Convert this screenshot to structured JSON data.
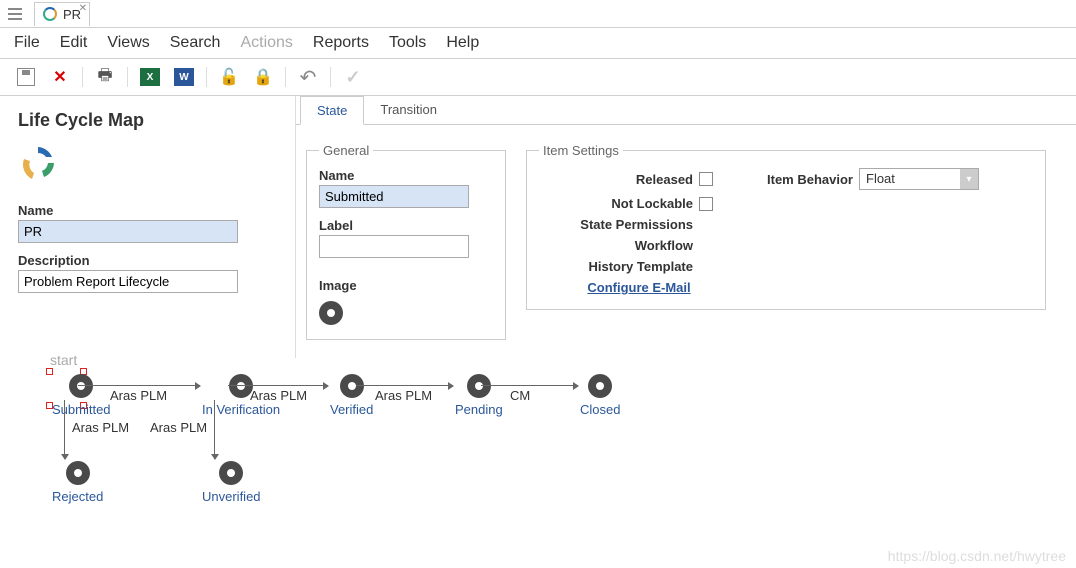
{
  "tab": {
    "title": "PR"
  },
  "menu": {
    "file": "File",
    "edit": "Edit",
    "views": "Views",
    "search": "Search",
    "actions": "Actions",
    "reports": "Reports",
    "tools": "Tools",
    "help": "Help"
  },
  "left": {
    "title": "Life Cycle Map",
    "name_label": "Name",
    "name_value": "PR",
    "desc_label": "Description",
    "desc_value": "Problem Report Lifecycle"
  },
  "content_tabs": {
    "state": "State",
    "transition": "Transition"
  },
  "general": {
    "legend": "General",
    "name_label": "Name",
    "name_value": "Submitted",
    "label_label": "Label",
    "label_value": "",
    "image_label": "Image"
  },
  "settings": {
    "legend": "Item Settings",
    "released": "Released",
    "not_lockable": "Not Lockable",
    "state_permissions": "State Permissions",
    "workflow": "Workflow",
    "history_template": "History Template",
    "item_behavior": "Item Behavior",
    "behavior_value": "Float",
    "configure_email": "Configure E-Mail"
  },
  "diagram": {
    "start": "start",
    "states": {
      "submitted": "Submitted",
      "in_verification": "In Verification",
      "verified": "Verified",
      "pending": "Pending",
      "closed": "Closed",
      "rejected": "Rejected",
      "unverified": "Unverified"
    },
    "edges": {
      "aras": "Aras PLM",
      "cm": "CM"
    }
  },
  "watermark": "https://blog.csdn.net/hwytree"
}
